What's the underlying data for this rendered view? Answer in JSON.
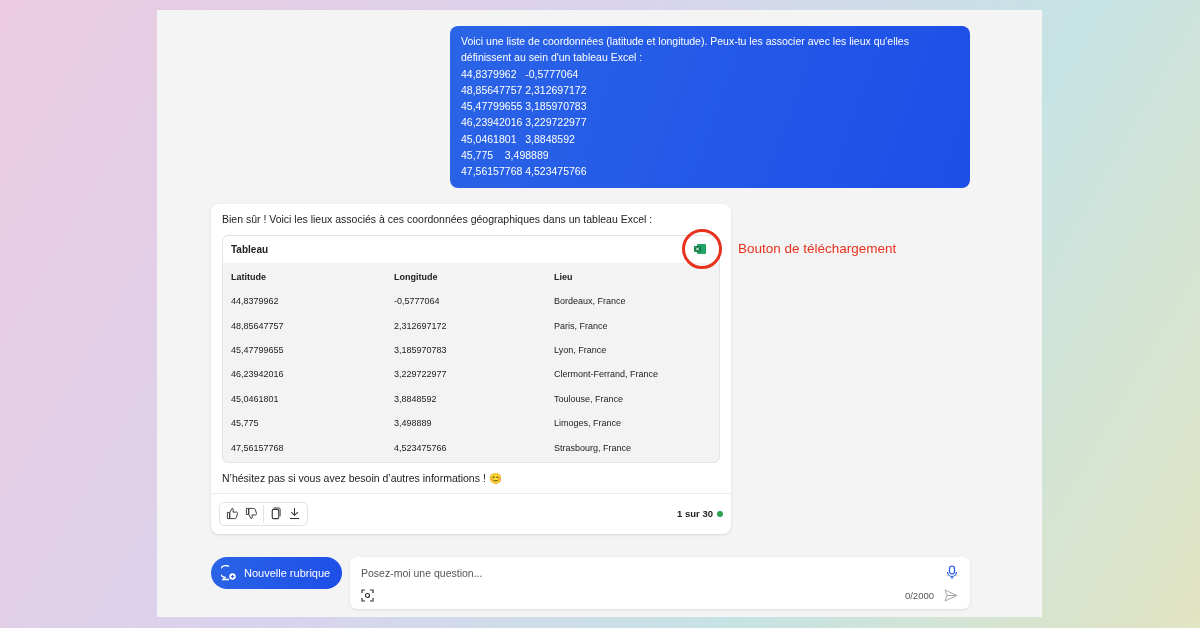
{
  "user_message": {
    "intro": "Voici une liste de coordonnées (latitude et longitude). Peux-tu les associer avec les lieux qu'elles définissent au sein d'un tableau Excel :",
    "lines": [
      "44,8379962   -0,5777064",
      "48,85647757 2,312697172",
      "45,47799655 3,185970783",
      "46,23942016 3,229722977",
      "45,0461801   3,8848592",
      "45,775    3,498889",
      "47,56157768 4,523475766"
    ]
  },
  "answer": {
    "intro": "Bien sûr ! Voici les lieux associés à ces coordonnées géographiques dans un tableau Excel :",
    "table": {
      "title": "Tableau",
      "columns": [
        "Latitude",
        "Longitude",
        "Lieu"
      ],
      "rows": [
        [
          "44,8379962",
          "-0,5777064",
          "Bordeaux, France"
        ],
        [
          "48,85647757",
          "2,312697172",
          "Paris, France"
        ],
        [
          "45,47799655",
          "3,185970783",
          "Lyon, France"
        ],
        [
          "46,23942016",
          "3,229722977",
          "Clermont-Ferrand, France"
        ],
        [
          "45,0461801",
          "3,8848592",
          "Toulouse, France"
        ],
        [
          "45,775",
          "3,498889",
          "Limoges, France"
        ],
        [
          "47,56157768",
          "4,523475766",
          "Strasbourg, France"
        ]
      ]
    },
    "outro": "N’hésitez pas si vous avez besoin d’autres informations ! 😊",
    "counter": "1 sur 30"
  },
  "annotation": {
    "label": "Bouton de téléchargement"
  },
  "new_topic_button": "Nouvelle rubrique",
  "input": {
    "placeholder": "Posez-moi une question...",
    "char_count": "0/2000"
  }
}
